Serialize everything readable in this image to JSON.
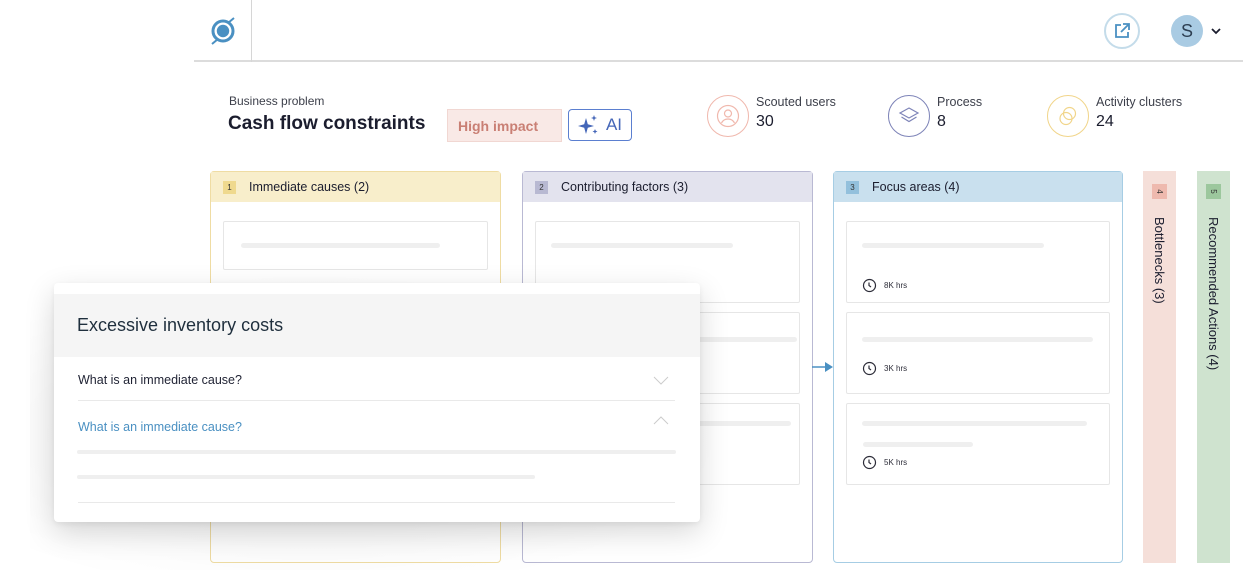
{
  "header": {
    "logo_icon": "orbit-logo-icon",
    "open_external_icon": "open-external-icon",
    "user_initial": "S",
    "user_menu_icon": "chevron-down-icon"
  },
  "problem": {
    "label": "Business problem",
    "title": "Cash flow constraints",
    "impact": "High impact",
    "ai_label": "AI",
    "ai_icon": "sparkles-icon"
  },
  "stats": [
    {
      "label": "Scouted users",
      "value": "30",
      "icon": "user-icon",
      "color": "#f0b8ad"
    },
    {
      "label": "Process",
      "value": "8",
      "icon": "layers-icon",
      "color": "#7e84b8"
    },
    {
      "label": "Activity clusters",
      "value": "24",
      "icon": "clusters-icon",
      "color": "#f1d58a"
    }
  ],
  "columns": [
    {
      "num": "1",
      "title": "Immediate causes (2)",
      "head_bg": "#f8eecb",
      "border": "#efdca3",
      "num_bg": "#efd98e"
    },
    {
      "num": "2",
      "title": "Contributing factors (3)",
      "head_bg": "#e3e3ee",
      "border": "#b9b9d3",
      "num_bg": "#b8b9d2"
    },
    {
      "num": "3",
      "title": "Focus areas (4)",
      "head_bg": "#c9e0ee",
      "border": "#a6cde4",
      "num_bg": "#93c0dc",
      "cards": [
        {
          "time": "8K hrs"
        },
        {
          "time": "3K hrs"
        },
        {
          "time": "5K hrs"
        }
      ]
    },
    {
      "num": "4",
      "title": "Bottlenecks (3)",
      "bg": "#f5dfd9",
      "num_bg": "#eeb9ae"
    },
    {
      "num": "5",
      "title": "Recommended Actions (4)",
      "bg": "#cfe3cf",
      "num_bg": "#9cc79d"
    }
  ],
  "panel": {
    "title": "Excessive inventory costs",
    "questions": [
      {
        "text": "What is an immediate cause?",
        "state": "collapsed"
      },
      {
        "text": "What is an immediate cause?",
        "state": "expanded"
      }
    ]
  },
  "colors": {
    "accent": "#4a90c2",
    "link": "#4a90c2"
  }
}
